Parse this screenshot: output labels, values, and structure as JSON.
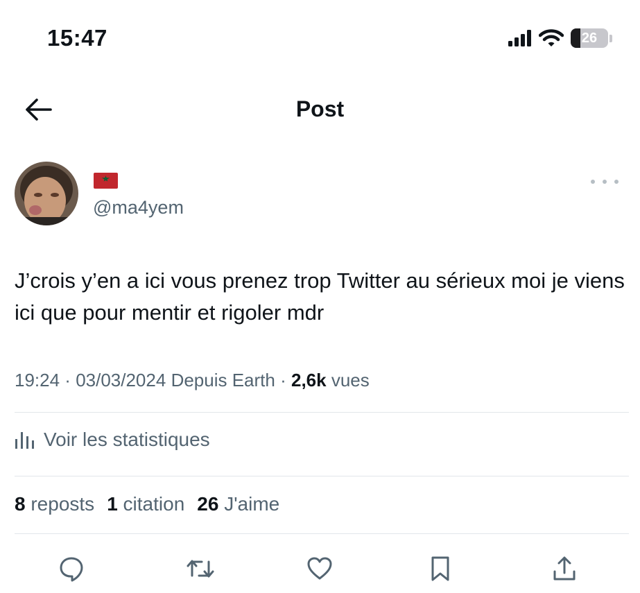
{
  "status_bar": {
    "time": "15:47",
    "battery_level": "26",
    "icons": [
      "cellular-signal-icon",
      "wifi-icon",
      "battery-icon"
    ]
  },
  "header": {
    "title": "Post",
    "back_icon": "arrow-left-icon"
  },
  "author": {
    "flag_icon": "morocco-flag-icon",
    "handle": "@ma4yem",
    "more_icon": "more-horizontal-icon"
  },
  "post": {
    "text": "J’crois y’en a ici vous prenez trop Twitter au sérieux moi je viens ici que pour mentir et rigoler mdr"
  },
  "meta": {
    "time": "19:24",
    "separator": " · ",
    "date": "03/03/2024",
    "source": "Depuis Earth",
    "views_count": "2,6k",
    "views_label": "vues"
  },
  "stats_link": {
    "label": "Voir les statistiques",
    "icon": "analytics-icon"
  },
  "counts": {
    "reposts_count": "8",
    "reposts_label": "reposts",
    "citations_count": "1",
    "citations_label": "citation",
    "likes_count": "26",
    "likes_label": "J'aime"
  },
  "actions": [
    "reply-icon",
    "repost-icon",
    "like-icon",
    "bookmark-icon",
    "share-icon"
  ],
  "colors": {
    "text_primary": "#0f1419",
    "text_secondary": "#536471",
    "divider": "#e1e6ea",
    "flag_red": "#c1272d",
    "flag_green": "#006233"
  }
}
